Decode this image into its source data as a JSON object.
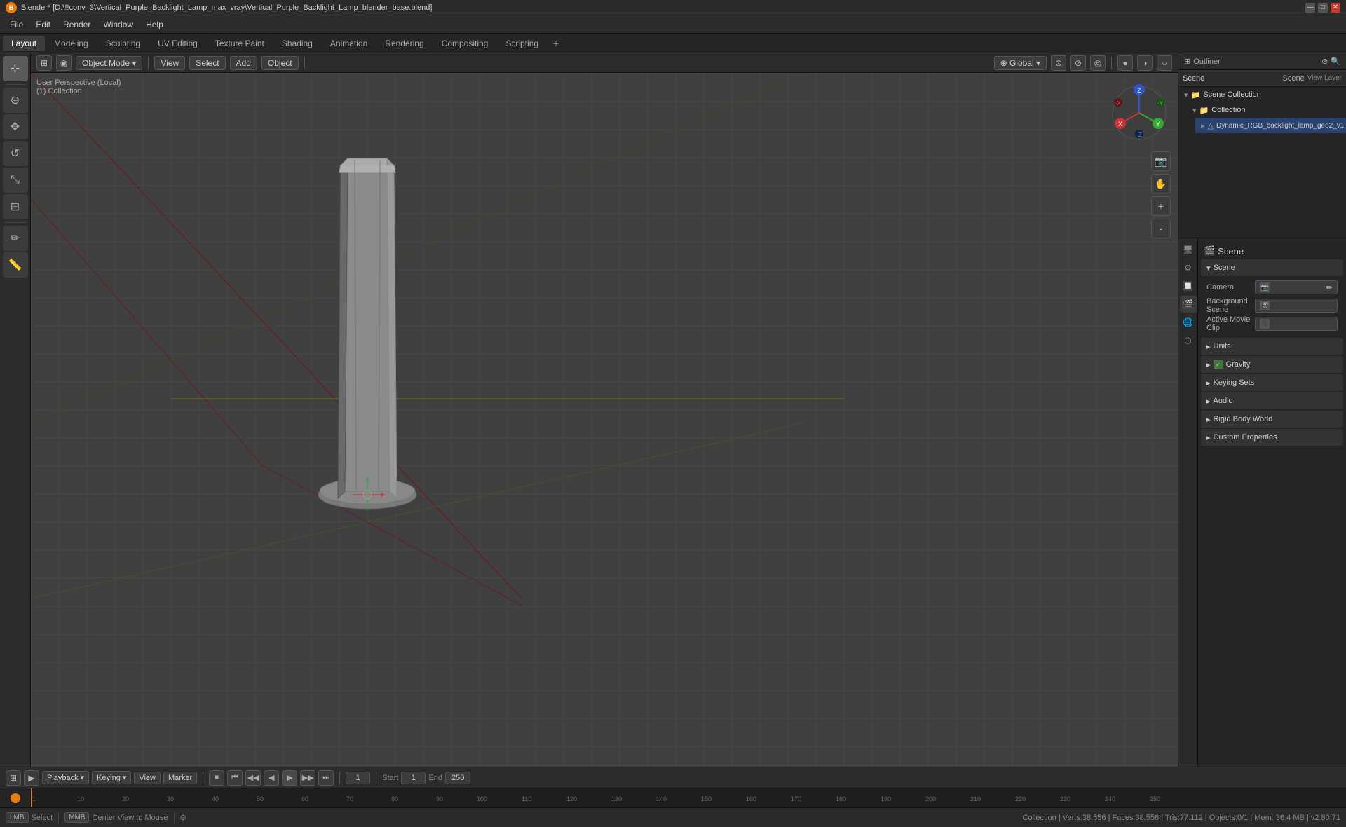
{
  "titlebar": {
    "title": "Blender* [D:\\!!conv_3\\Vertical_Purple_Backlight_Lamp_max_vray\\Vertical_Purple_Backlight_Lamp_blender_base.blend]",
    "logo": "B",
    "minimize": "—",
    "maximize": "□",
    "close": "✕"
  },
  "menubar": {
    "items": [
      "File",
      "Edit",
      "Render",
      "Window",
      "Help"
    ]
  },
  "workspace_tabs": {
    "tabs": [
      "Layout",
      "Modeling",
      "Sculpting",
      "UV Editing",
      "Texture Paint",
      "Shading",
      "Animation",
      "Rendering",
      "Compositing",
      "Scripting"
    ],
    "active": "Layout",
    "add_label": "+"
  },
  "viewport_header": {
    "editor_type": "⊞",
    "mode_dropdown": "Object Mode",
    "view_menu": "View",
    "select_menu": "Select",
    "add_menu": "Add",
    "object_menu": "Object",
    "global_label": "Global",
    "icons": [
      "⊕",
      "⊗",
      "⊘",
      "◎",
      "⬡",
      "△",
      "⊙"
    ]
  },
  "viewport_info": {
    "line1": "User Perspective (Local)",
    "line2": "(1) Collection"
  },
  "outliner": {
    "header_title": "Scene Collection",
    "items": [
      {
        "label": "Scene Collection",
        "icon": "📁",
        "indent": 0,
        "active": false
      },
      {
        "label": "Collection",
        "icon": "📁",
        "indent": 1,
        "active": false
      },
      {
        "label": "Dynamic_RGB_backlight_lamp_geo2_v1",
        "icon": "△",
        "indent": 2,
        "active": true
      }
    ]
  },
  "properties": {
    "title": "Scene",
    "icon": "🎬",
    "sections": [
      {
        "label": "Scene",
        "expanded": true,
        "rows": [
          {
            "label": "Camera",
            "value": "",
            "has_icon": true
          },
          {
            "label": "Background Scene",
            "value": "",
            "has_icon": true
          },
          {
            "label": "Active Movie Clip",
            "value": "",
            "has_icon": true
          }
        ]
      },
      {
        "label": "Units",
        "expanded": false,
        "rows": []
      },
      {
        "label": "Gravity",
        "expanded": false,
        "rows": [],
        "has_checkbox": true
      },
      {
        "label": "Keying Sets",
        "expanded": false,
        "rows": []
      },
      {
        "label": "Audio",
        "expanded": false,
        "rows": []
      },
      {
        "label": "Rigid Body World",
        "expanded": false,
        "rows": []
      },
      {
        "label": "Custom Properties",
        "expanded": false,
        "rows": []
      }
    ]
  },
  "props_sidebar_icons": [
    {
      "icon": "🖥",
      "label": "render-props",
      "active": false
    },
    {
      "icon": "📊",
      "label": "output-props",
      "active": false
    },
    {
      "icon": "🖼",
      "label": "view-layer-props",
      "active": false
    },
    {
      "icon": "🎬",
      "label": "scene-props",
      "active": true
    },
    {
      "icon": "🌍",
      "label": "world-props",
      "active": false
    },
    {
      "icon": "🔧",
      "label": "object-props",
      "active": false
    }
  ],
  "navigation_gizmo": {
    "x_color": "#cc3333",
    "y_color": "#33aa33",
    "z_color": "#3366cc",
    "x_neg_color": "#661111",
    "y_neg_color": "#115511",
    "z_neg_color": "#112244"
  },
  "playback": {
    "playback_label": "Playback",
    "keying_label": "Keying",
    "view_label": "View",
    "marker_label": "Marker",
    "frame_current": "1",
    "start_label": "Start",
    "start_frame": "1",
    "end_label": "End",
    "end_frame": "250",
    "controls": [
      "⏮",
      "⏪",
      "⏭◀",
      "▶",
      "⏩",
      "⏭"
    ]
  },
  "frame_ruler": {
    "marks": [
      1,
      10,
      20,
      30,
      40,
      50,
      60,
      70,
      80,
      90,
      100,
      110,
      120,
      130,
      140,
      150,
      160,
      170,
      180,
      190,
      200,
      210,
      220,
      230,
      240,
      250
    ],
    "current_frame": 1
  },
  "status_bar": {
    "left_key": "Select",
    "middle_text": "Center View to Mouse",
    "right_icon": "⊙",
    "stats": "Collection | Verts:38.556 | Faces:38.556 | Tris:77.112 | Objects:0/1 | Mem: 36.4 MB | v2.80.71"
  },
  "viewport_right_controls": [
    "🔲",
    "✋",
    "🔍",
    "🔍"
  ],
  "header_scene": "Scene",
  "view_layer": "View Layer"
}
